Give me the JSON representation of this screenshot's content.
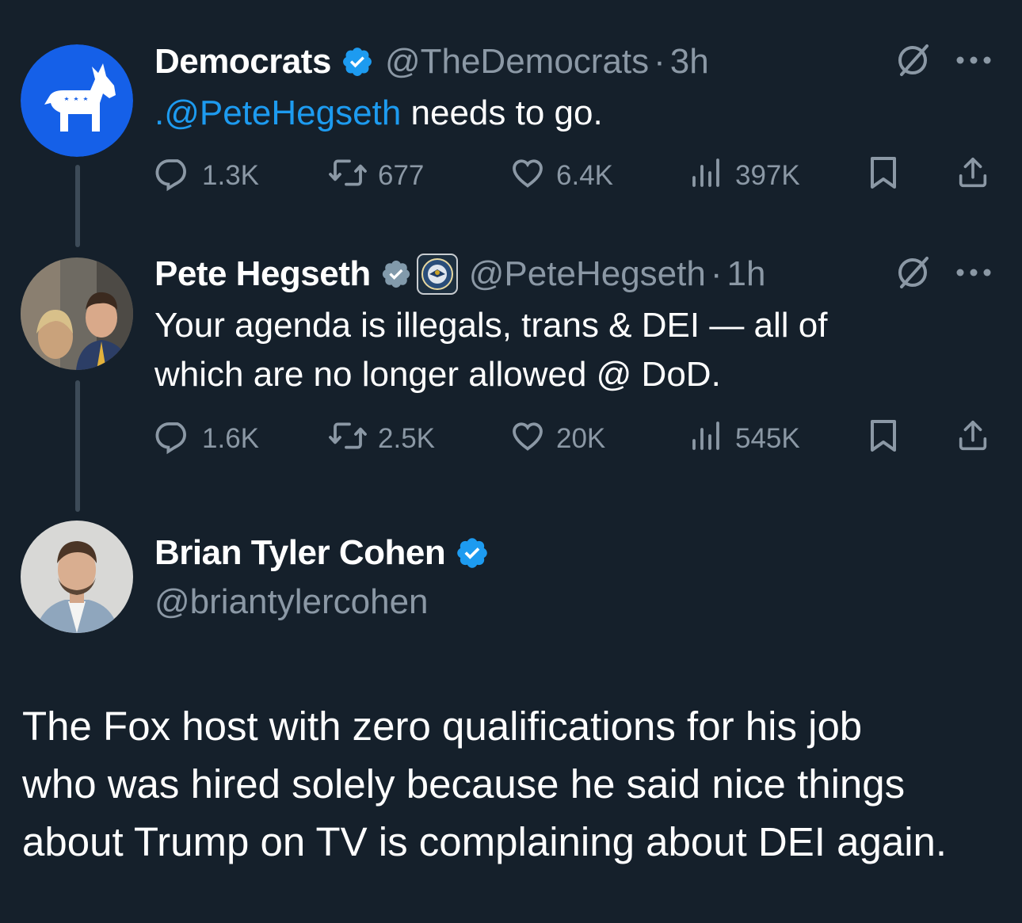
{
  "tweets": [
    {
      "name": "Democrats",
      "handle": "@TheDemocrats",
      "separator": "·",
      "time": "3h",
      "text_mention": ".@PeteHegseth",
      "text_rest": " needs to go.",
      "stats": {
        "replies": "1.3K",
        "retweets": "677",
        "likes": "6.4K",
        "views": "397K"
      }
    },
    {
      "name": "Pete Hegseth",
      "handle": "@PeteHegseth",
      "separator": "·",
      "time": "1h",
      "text_line1": "Your agenda is illegals, trans & DEI — all of",
      "text_line2": "which are no longer allowed @ DoD.",
      "stats": {
        "replies": "1.6K",
        "retweets": "2.5K",
        "likes": "20K",
        "views": "545K"
      }
    }
  ],
  "author": {
    "name": "Brian Tyler Cohen",
    "handle": "@briantylercohen"
  },
  "main_text": {
    "line1": "The Fox host with zero qualifications for his job",
    "line2": "who was hired solely because he said nice things",
    "line3": "about Trump on TV is complaining about DEI again."
  },
  "icons": [
    "grok-icon",
    "more-icon",
    "reply-icon",
    "retweet-icon",
    "like-icon",
    "views-icon",
    "bookmark-icon",
    "share-icon",
    "verified-badge-icon",
    "affiliate-badge-icon"
  ],
  "colors": {
    "background": "#15202b",
    "text": "#ffffff",
    "secondary": "#8b98a5",
    "accent": "#1d9bf0",
    "thread_line": "#3d4b58",
    "verified_gray": "#829aab"
  }
}
